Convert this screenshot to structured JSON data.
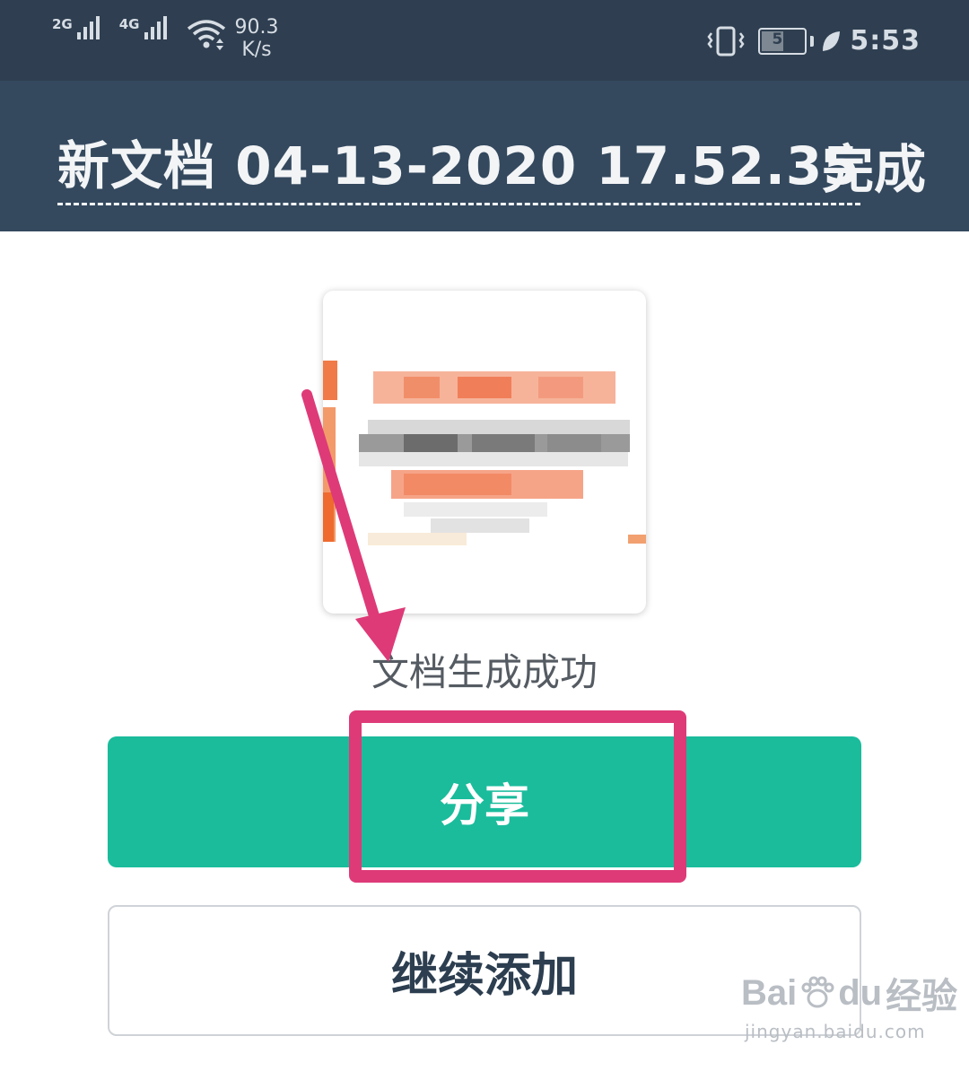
{
  "status_bar": {
    "network_1": "2G",
    "network_2": "4G",
    "speed_value": "90.3",
    "speed_unit": "K/s",
    "battery": "51",
    "time": "5:53",
    "icons": [
      "signal-icon",
      "wifi-icon",
      "vibrate-icon",
      "battery-icon",
      "leaf-icon"
    ]
  },
  "header": {
    "title": "新文档 04-13-2020 17.52.35",
    "done_label": "完成"
  },
  "main": {
    "success_text": "文档生成成功",
    "share_label": "分享",
    "continue_label": "继续添加"
  },
  "watermark": {
    "brand_prefix": "Bai",
    "brand_suffix": "du",
    "brand_cn": "经验",
    "url": "jingyan.baidu.com"
  },
  "colors": {
    "status_bar_bg": "#2f3f51",
    "app_bar_bg": "#34495e",
    "share_button": "#1abc9c",
    "annotation": "#de3a78",
    "success_text": "#555b62"
  }
}
